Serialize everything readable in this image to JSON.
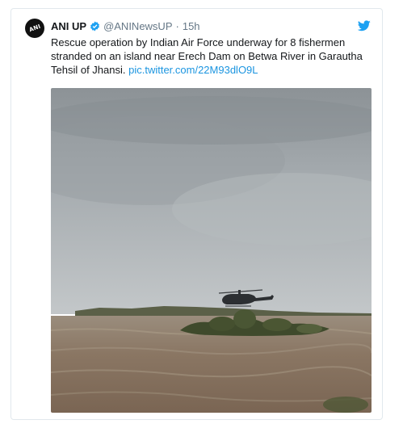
{
  "tweet": {
    "display_name": "ANI UP",
    "handle": "@ANINewsUP",
    "separator": "·",
    "time": "15h",
    "text": "Rescue operation by Indian Air Force underway for 8 fishermen stranded on an island near Erech Dam on Betwa River in Garautha Tehsil of Jhansi. ",
    "link": "pic.twitter.com/22M93dlO9L"
  },
  "avatar": {
    "logo": "ANI"
  },
  "icons": {
    "verified": "verified-badge-icon",
    "twitter": "twitter-bird-icon"
  },
  "colors": {
    "link": "#1b95e0",
    "verified": "#1da1f2",
    "bird": "#1da1f2",
    "muted": "#657786"
  }
}
